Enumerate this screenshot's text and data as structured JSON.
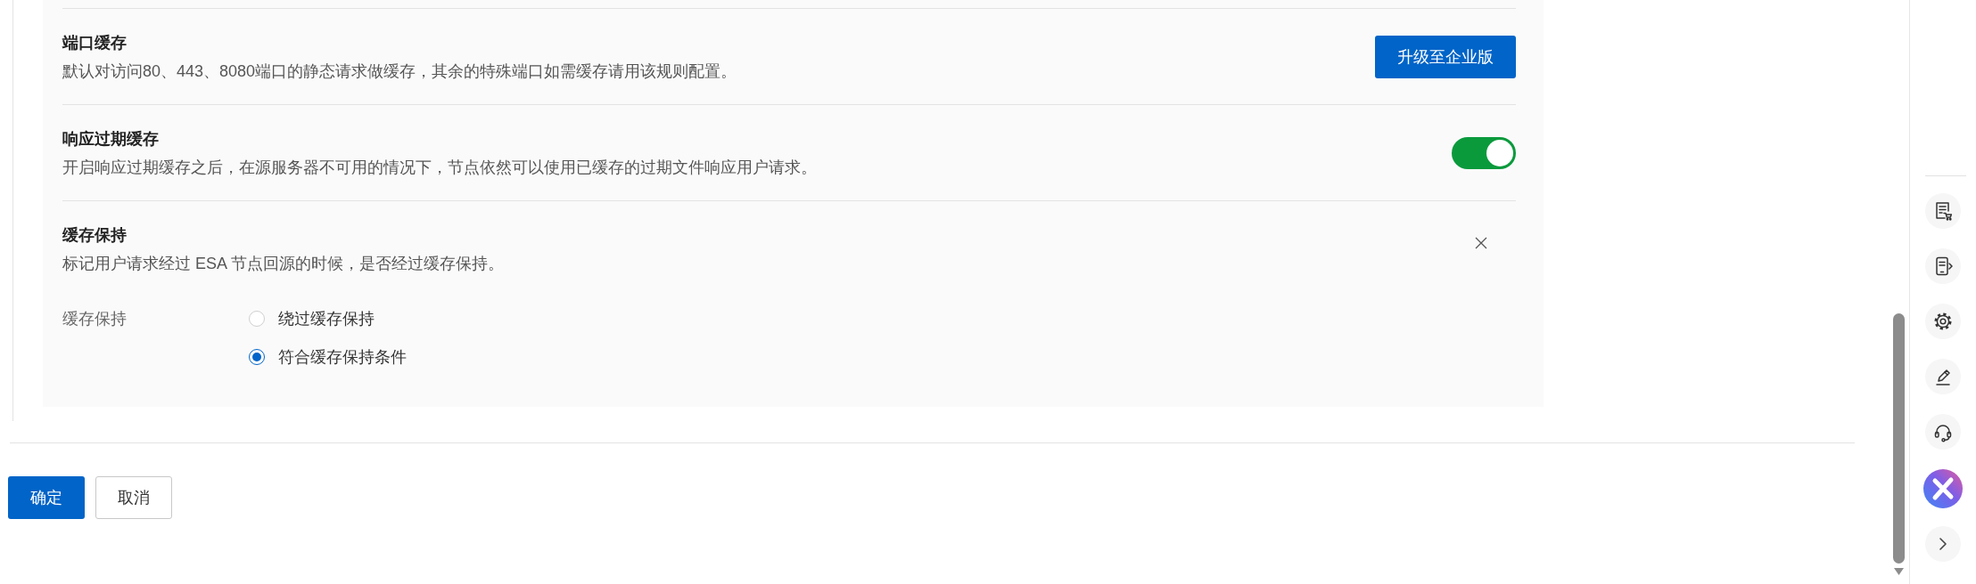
{
  "settings": [
    {
      "kind": "upgrade",
      "title": "端口缓存",
      "description": "默认对访问80、443、8080端口的静态请求做缓存，其余的特殊端口如需缓存请用该规则配置。",
      "button": "升级至企业版"
    },
    {
      "kind": "toggle",
      "title": "响应过期缓存",
      "description": "开启响应过期缓存之后，在源服务器不可用的情况下，节点依然可以使用已缓存的过期文件响应用户请求。",
      "on": true
    },
    {
      "kind": "options",
      "title": "缓存保持",
      "description": "标记用户请求经过 ESA 节点回源的时候，是否经过缓存保持。",
      "field_label": "缓存保持",
      "options": [
        {
          "label": "绕过缓存保持",
          "selected": false
        },
        {
          "label": "符合缓存保持条件",
          "selected": true
        }
      ]
    }
  ],
  "footer_buttons": [
    {
      "label": "确定",
      "kind": "primary"
    },
    {
      "label": "取消",
      "kind": "default"
    }
  ]
}
